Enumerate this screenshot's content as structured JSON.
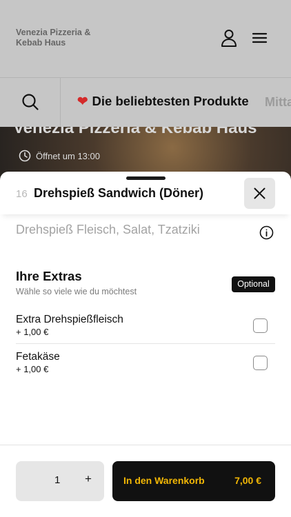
{
  "restaurant": {
    "brand_name": "Venezia Pizzeria &\nKebab Haus",
    "hero_title": "Venezia Pizzeria & Kebab Haus",
    "opening_info": "Öffnet um 13:00"
  },
  "category_nav": {
    "active_icon": "heart",
    "active_label": "Die beliebtesten Produkte",
    "next_label": "Mittagsmenü"
  },
  "item": {
    "number": "16",
    "title": "Drehspieß Sandwich (Döner)",
    "description": "Drehspieß Fleisch, Salat, Tzatziki"
  },
  "extras": {
    "title": "Ihre Extras",
    "subtitle": "Wähle so viele wie du möchtest",
    "badge": "Optional",
    "options": [
      {
        "name": "Extra Drehspießfleisch",
        "price": "+ 1,00 €",
        "checked": false
      },
      {
        "name": "Fetakäse",
        "price": "+ 1,00 €",
        "checked": false
      }
    ]
  },
  "order": {
    "quantity": "1",
    "plus_label": "+",
    "cart_label": "In den Warenkorb",
    "cart_price": "7,00 €"
  },
  "colors": {
    "accent_yellow": "#f2b705",
    "heart_red": "#d42a2a",
    "dark": "#111111",
    "overlay_gray": "#c6c6c6"
  }
}
